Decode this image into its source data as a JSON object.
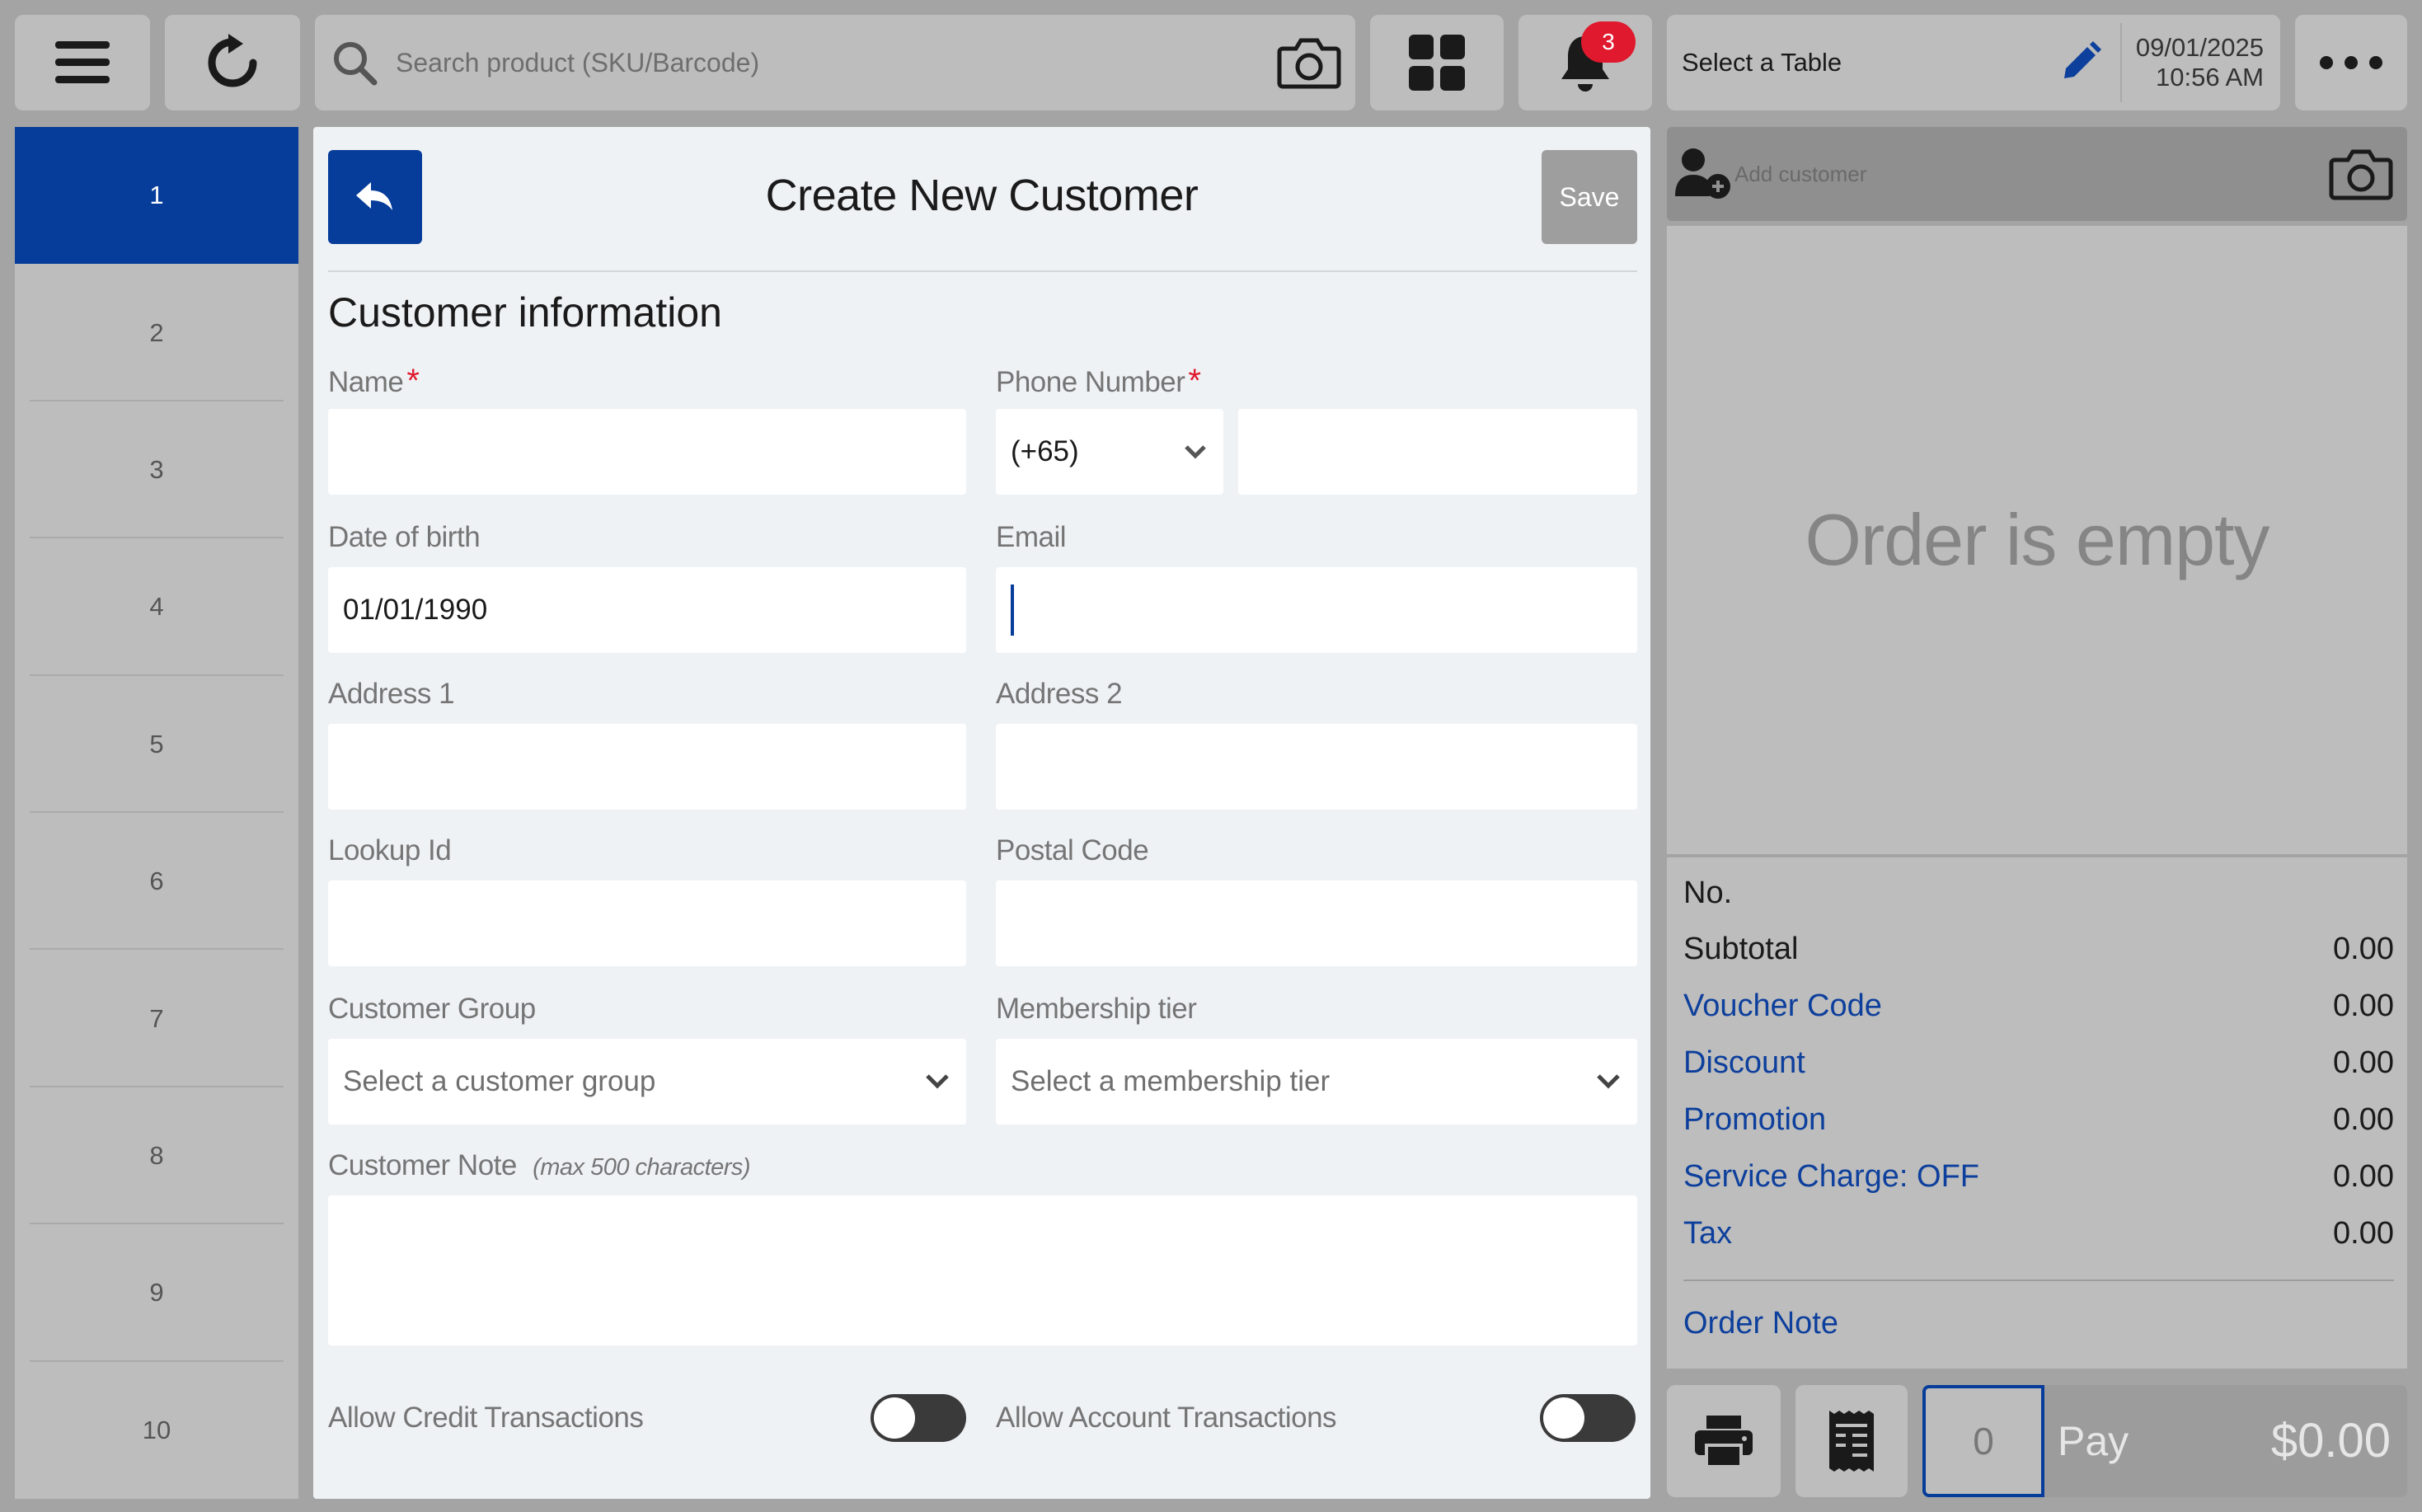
{
  "topbar": {
    "search_placeholder": "Search product (SKU/Barcode)",
    "notification_count": "3",
    "table_label": "Select a Table",
    "date": "09/01/2025",
    "time": "10:56 AM"
  },
  "tabs": [
    "1",
    "2",
    "3",
    "4",
    "5",
    "6",
    "7",
    "8",
    "9",
    "10"
  ],
  "form": {
    "title": "Create New Customer",
    "save_label": "Save",
    "section_title": "Customer information",
    "required_mark": "*",
    "name_label": "Name",
    "name_value": "",
    "phone_label": "Phone Number",
    "phone_code": "(+65)",
    "phone_value": "",
    "dob_label": "Date of birth",
    "dob_value": "01/01/1990",
    "email_label": "Email",
    "email_value": "",
    "address1_label": "Address 1",
    "address2_label": "Address 2",
    "lookup_label": "Lookup Id",
    "postal_label": "Postal Code",
    "group_label": "Customer Group",
    "group_placeholder": "Select a customer group",
    "tier_label": "Membership tier",
    "tier_placeholder": "Select a membership tier",
    "note_label": "Customer Note",
    "note_hint": "(max 500 characters)",
    "credit_label": "Allow Credit Transactions",
    "credit_on": false,
    "account_label": "Allow Account Transactions",
    "account_on": false
  },
  "order": {
    "add_customer_placeholder": "Add customer",
    "empty_message": "Order is empty",
    "no_label": "No.",
    "rows": [
      {
        "label": "Subtotal",
        "value": "0.00",
        "link": false
      },
      {
        "label": "Voucher Code",
        "value": "0.00",
        "link": true
      },
      {
        "label": "Discount",
        "value": "0.00",
        "link": true
      },
      {
        "label": "Promotion",
        "value": "0.00",
        "link": true
      },
      {
        "label": "Service Charge: OFF",
        "value": "0.00",
        "link": true
      },
      {
        "label": "Tax",
        "value": "0.00",
        "link": true
      }
    ],
    "order_note": "Order Note",
    "qty": "0",
    "pay_label": "Pay",
    "pay_amount": "$0.00"
  },
  "colors": {
    "accent": "#063c9a",
    "background": "#a4a4a4",
    "panel": "#eff2f5",
    "required": "#e0192e",
    "badge": "#e0192e"
  }
}
